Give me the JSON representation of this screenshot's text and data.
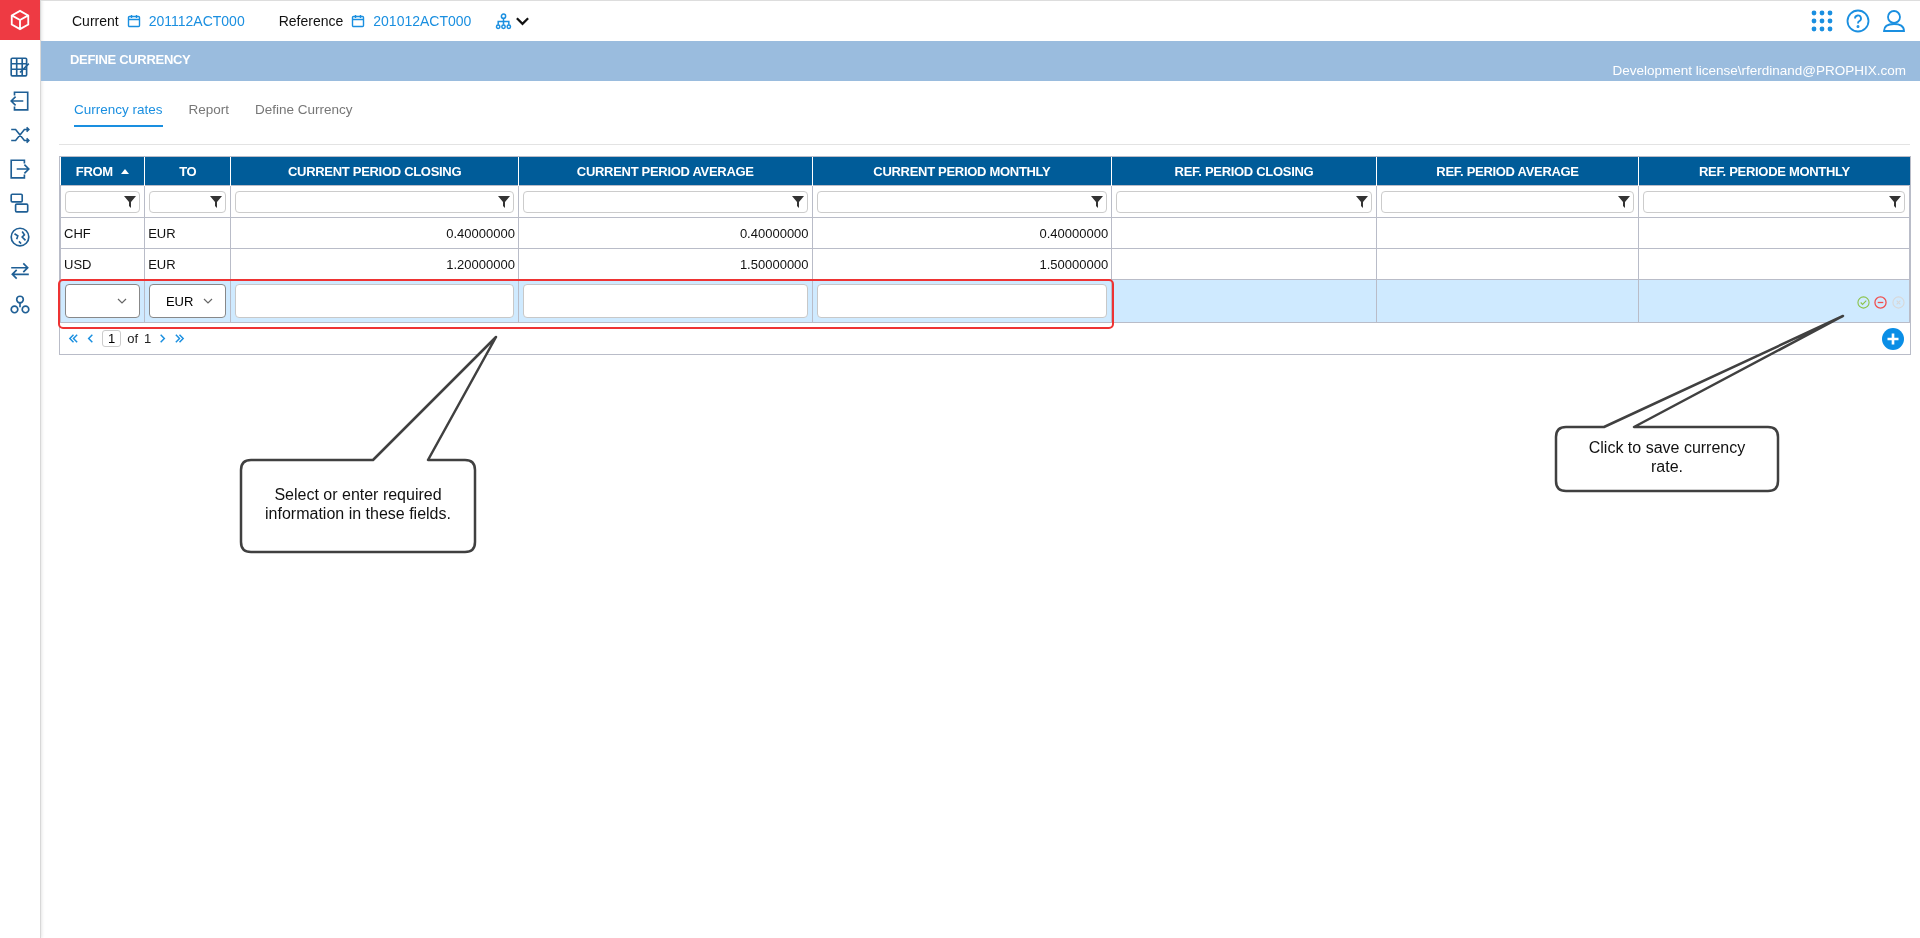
{
  "topbar": {
    "current_label": "Current",
    "current_value": "201112ACT000",
    "reference_label": "Reference",
    "reference_value": "201012ACT000"
  },
  "banner": {
    "title": "DEFINE CURRENCY",
    "user": "Development license\\rferdinand@PROPHIX.com"
  },
  "tabs": [
    {
      "label": "Currency rates",
      "selected": true
    },
    {
      "label": "Report",
      "selected": false
    },
    {
      "label": "Define Currency",
      "selected": false
    }
  ],
  "table": {
    "columns": [
      {
        "label": "FROM",
        "sorted": true
      },
      {
        "label": "TO",
        "sorted": false
      },
      {
        "label": "CURRENT PERIOD CLOSING",
        "sorted": false
      },
      {
        "label": "CURRENT PERIOD AVERAGE",
        "sorted": false
      },
      {
        "label": "CURRENT PERIOD MONTHLY",
        "sorted": false
      },
      {
        "label": "REF. PERIOD CLOSING",
        "sorted": false
      },
      {
        "label": "REF. PERIOD AVERAGE",
        "sorted": false
      },
      {
        "label": "REF. PERIODE MONTHLY",
        "sorted": false
      }
    ],
    "rows": [
      {
        "from": "CHF",
        "to": "EUR",
        "values": [
          "0.40000000",
          "0.40000000",
          "0.40000000"
        ]
      },
      {
        "from": "USD",
        "to": "EUR",
        "values": [
          "1.20000000",
          "1.50000000",
          "1.50000000"
        ]
      }
    ],
    "new_row": {
      "to": "EUR"
    },
    "pager": {
      "page": "1",
      "of_label": "of",
      "total": "1"
    }
  },
  "callouts": [
    {
      "text": "Select or enter required information in these fields."
    },
    {
      "text": "Click to save currency rate."
    }
  ]
}
